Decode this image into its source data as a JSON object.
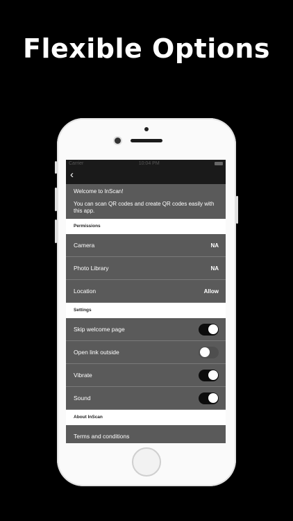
{
  "headline": "Flexible Options",
  "status_bar": {
    "carrier": "Carrier",
    "time": "10:04 PM"
  },
  "welcome": {
    "title": "Welcome to InScan!",
    "body": "You can scan QR codes and create QR codes easily with this app."
  },
  "permissions": {
    "header": "Permissions",
    "items": [
      {
        "label": "Camera",
        "value": "NA"
      },
      {
        "label": "Photo Library",
        "value": "NA"
      },
      {
        "label": "Location",
        "value": "Allow"
      }
    ]
  },
  "settings": {
    "header": "Settings",
    "items": [
      {
        "label": "Skip welcome page",
        "on": true
      },
      {
        "label": "Open link outside",
        "on": false
      },
      {
        "label": "Vibrate",
        "on": true
      },
      {
        "label": "Sound",
        "on": true
      }
    ]
  },
  "about": {
    "header": "About InScan",
    "items": [
      {
        "label": "Terms and conditions"
      }
    ]
  },
  "icons": {
    "back": "chevron-left-icon"
  }
}
